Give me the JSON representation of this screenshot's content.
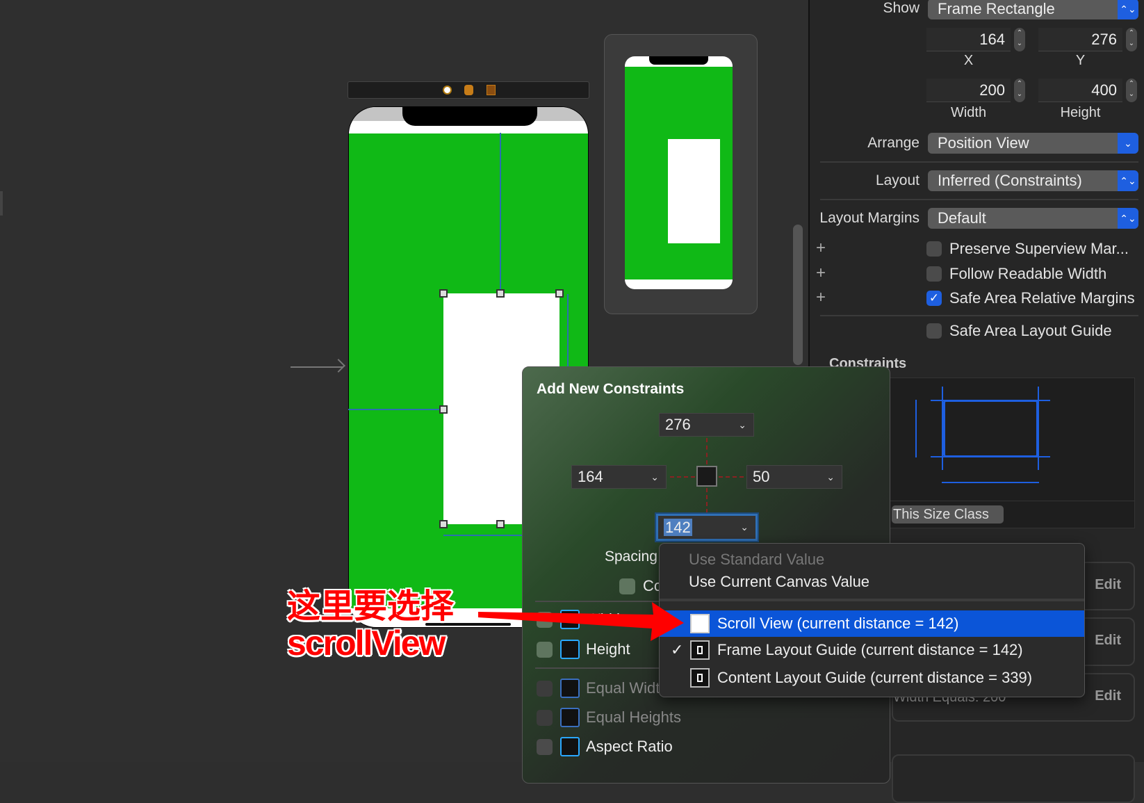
{
  "inspector": {
    "show": {
      "label": "Show",
      "value": "Frame Rectangle"
    },
    "x": {
      "value": "164",
      "label": "X"
    },
    "y": {
      "value": "276",
      "label": "Y"
    },
    "width": {
      "value": "200",
      "label": "Width"
    },
    "height": {
      "value": "400",
      "label": "Height"
    },
    "arrange": {
      "label": "Arrange",
      "value": "Position View"
    },
    "layout": {
      "label": "Layout",
      "value": "Inferred (Constraints)"
    },
    "layout_margins": {
      "label": "Layout Margins",
      "value": "Default"
    },
    "checkboxes": [
      {
        "label": "Preserve Superview Mar...",
        "checked": false
      },
      {
        "label": "Follow Readable Width",
        "checked": false
      },
      {
        "label": "Safe Area Relative Margins",
        "checked": true
      },
      {
        "label": "Safe Area Layout Guide",
        "checked": false
      }
    ],
    "constraints_header": "Constraints",
    "size_class_button": "This Size Class",
    "edit_label": "Edit",
    "width_equals": "Width Equals:  200"
  },
  "popover": {
    "title": "Add New Constraints",
    "top": "276",
    "left": "164",
    "right": "50",
    "bottom": "142",
    "spacing_label": "Spacing",
    "constrain_label": "Co",
    "rows": [
      {
        "label": "Width",
        "enabled": true
      },
      {
        "label": "Height",
        "enabled": true
      },
      {
        "label": "Equal Widths",
        "enabled": false
      },
      {
        "label": "Equal Heights",
        "enabled": false
      },
      {
        "label": "Aspect Ratio",
        "enabled": true
      }
    ]
  },
  "menu": {
    "use_standard": "Use Standard Value",
    "use_canvas": "Use Current Canvas Value",
    "items": [
      {
        "label": "Scroll View (current distance = 142)",
        "highlighted": true,
        "checked": false
      },
      {
        "label": "Frame Layout Guide (current distance = 142)",
        "highlighted": false,
        "checked": true
      },
      {
        "label": "Content Layout Guide (current distance = 339)",
        "highlighted": false,
        "checked": false
      }
    ],
    "checkmark": "✓"
  },
  "annotation": {
    "line1": "这里要选择",
    "line2": "scrollView",
    "color": "#ff0000"
  },
  "colors": {
    "accent": "#1e5fe0",
    "view_green": "#10b916"
  }
}
